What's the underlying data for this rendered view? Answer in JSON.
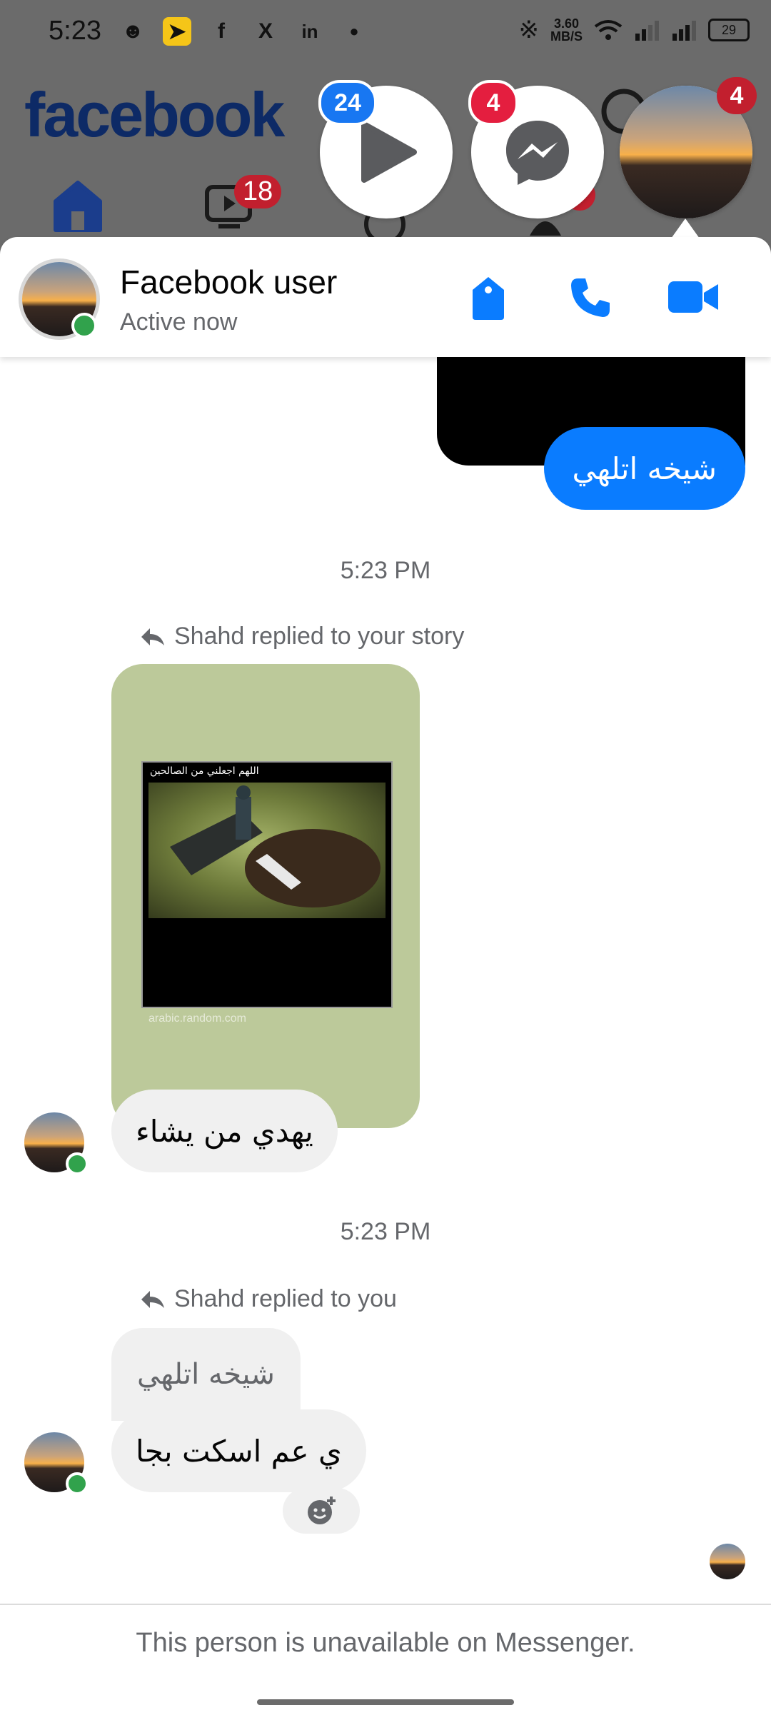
{
  "status_bar": {
    "time": "5:23",
    "net_speed_value": "3.60",
    "net_speed_unit": "MB/S",
    "battery": "29"
  },
  "background": {
    "logo": "facebook",
    "watch_badge": "18"
  },
  "chat_heads": {
    "video_badge": "24",
    "messenger_badge": "4",
    "profile_badge": "4"
  },
  "header": {
    "name": "Facebook user",
    "status": "Active now",
    "icons": [
      "tag-icon",
      "phone-icon",
      "video-camera-icon"
    ]
  },
  "messages": {
    "sent_text": "شيخه اتلهي",
    "time_1": "5:23 PM",
    "story_reply_note": "Shahd replied to your story",
    "story_caption": "اللهم اجعلني من الصالحين",
    "story_watermark": "arabic.random.com",
    "story_reply_text": "يهدي من يشاء",
    "time_2": "5:23 PM",
    "reply_note": "Shahd replied to you",
    "quoted_text": "شيخه اتلهي",
    "reply_text": "ي عم اسكت بجا"
  },
  "footer": {
    "unavailable_text": "This person is unavailable on Messenger."
  },
  "colors": {
    "brand_blue": "#0a7cff",
    "fb_logo": "#0d2a66",
    "online_green": "#31a24c",
    "badge_red": "#c21f2e",
    "received_bubble": "#f0f0f0"
  }
}
